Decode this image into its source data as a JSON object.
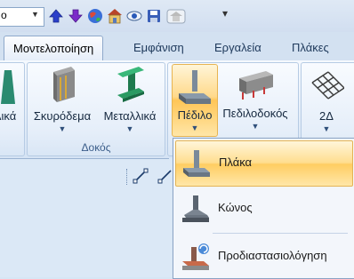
{
  "quick_access": {
    "combo_value": "o",
    "icons": [
      "arrow-up-icon",
      "arrow-down-icon",
      "globe-icon",
      "house-icon",
      "eye-icon",
      "save-icon",
      "build-icon"
    ],
    "more_glyph": "▾"
  },
  "tabs": [
    {
      "label": "Μοντελοποίηση",
      "active": true
    },
    {
      "label": "Εμφάνιση"
    },
    {
      "label": "Εργαλεία"
    },
    {
      "label": "Πλάκες"
    }
  ],
  "ribbon": {
    "partial_left_label": "λικά",
    "beam_group": {
      "label": "Δοκός",
      "buttons": [
        {
          "label": "Σκυρόδεμα",
          "icon": "concrete-beam-icon"
        },
        {
          "label": "Μεταλλικά",
          "icon": "steel-beam-icon"
        }
      ]
    },
    "foundation_group": {
      "buttons": [
        {
          "label": "Πέδιλο",
          "icon": "footing-icon",
          "active": true
        },
        {
          "label": "Πεδιλοδοκός",
          "icon": "strip-footing-icon"
        },
        {
          "label": "2Δ",
          "icon": "mesh-icon"
        }
      ]
    }
  },
  "dropdown_menu": {
    "items": [
      {
        "label": "Πλάκα",
        "icon": "footing-slab-icon",
        "highlighted": true
      },
      {
        "label": "Κώνος",
        "icon": "cone-footing-icon"
      },
      {
        "label": "Προδιαστασιολόγηση",
        "icon": "predimension-icon"
      }
    ]
  },
  "colors": {
    "accent_highlight": "#ffcd62",
    "ribbon_bg": "#dfeaf7",
    "tab_text": "#1e395b"
  }
}
